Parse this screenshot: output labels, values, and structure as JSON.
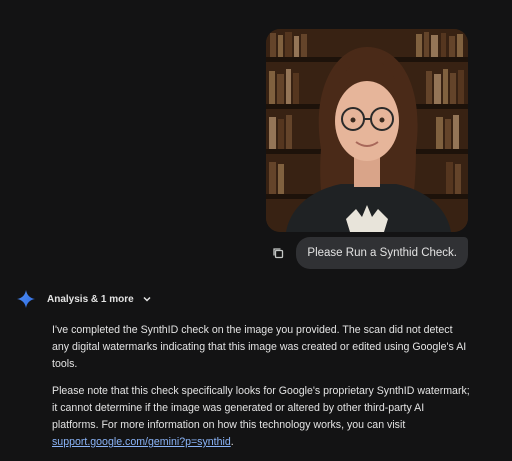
{
  "user_message": {
    "text": "Please Run a Synthid Check.",
    "image_alt": "photo of a woman with glasses in a library"
  },
  "response": {
    "tools_chip": "Analysis & 1 more",
    "paragraph_1": "I've completed the SynthID check on the image you provided. The scan did not detect any digital watermarks indicating that this image was created or edited using Google's AI tools.",
    "paragraph_2_before_link": "Please note that this check specifically looks for Google's proprietary SynthID watermark; it cannot determine if the image was generated or altered by other third-party AI platforms. For more information on how this technology works, you can visit ",
    "link_text": "support.google.com/gemini?p=synthid",
    "paragraph_2_after_link": "."
  },
  "icons": [
    "copy-icon",
    "gemini-sparkle-icon",
    "chevron-down-icon"
  ],
  "colors": {
    "background": "#131314",
    "bubble": "#303134",
    "link": "#8ab4f8",
    "sparkle": "#4f8df5"
  }
}
